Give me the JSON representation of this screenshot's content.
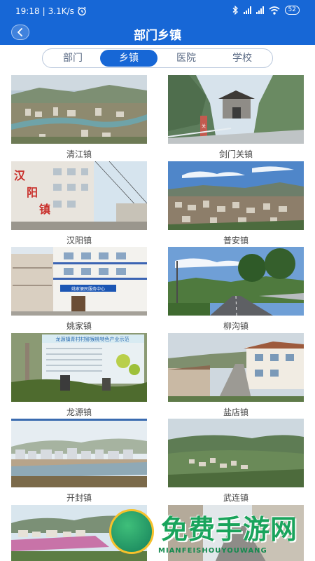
{
  "status_bar": {
    "time": "19:18",
    "separator": "|",
    "speed": "3.1K/s",
    "battery": "52"
  },
  "header": {
    "title": "部门乡镇",
    "background": "#1767d6"
  },
  "tabs": [
    {
      "label": "部门",
      "active": false
    },
    {
      "label": "乡镇",
      "active": true
    },
    {
      "label": "医院",
      "active": false
    },
    {
      "label": "学校",
      "active": false
    }
  ],
  "towns": [
    {
      "name": "清江镇"
    },
    {
      "name": "剑门关镇"
    },
    {
      "name": "汉阳镇"
    },
    {
      "name": "普安镇"
    },
    {
      "name": "姚家镇"
    },
    {
      "name": "柳沟镇"
    },
    {
      "name": "龙源镇"
    },
    {
      "name": "盐店镇"
    },
    {
      "name": "开封镇"
    },
    {
      "name": "武连镇"
    },
    {
      "name": ""
    },
    {
      "name": ""
    }
  ],
  "photo_text": {
    "hanyang_sign": "汉阳镇",
    "yaojia_sign": "姚家便民服务中心",
    "longyuan_banner": "龙源镇青村村猕猴桃特色产业示范",
    "jianmen_gate_sign": "剑门关"
  },
  "watermark": {
    "title": "免费手游网",
    "subtitle": "MIANFEISHOUYOUWANG"
  }
}
